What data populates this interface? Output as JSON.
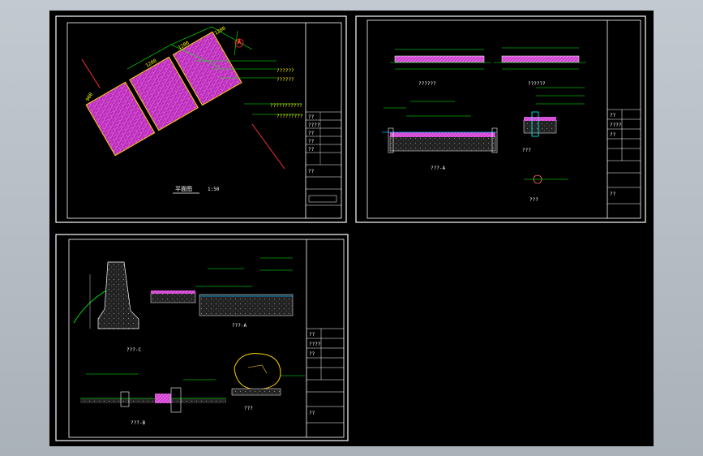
{
  "sheets": [
    {
      "id": "plan",
      "scale_label": "平面图",
      "scale_value": "1:50",
      "dims": [
        "1200",
        "1200",
        "1200",
        "900"
      ],
      "notes": [
        "??????",
        "??????",
        "???????????",
        "?????????"
      ],
      "title_block": [
        "??",
        "????",
        "??",
        "??",
        "??",
        "??"
      ]
    },
    {
      "id": "sections",
      "labels": [
        "??????",
        "??????",
        "???-A",
        "???",
        "???"
      ],
      "title_block": [
        "??",
        "????",
        "??",
        "??"
      ]
    },
    {
      "id": "details",
      "labels": [
        "???-C",
        "???-A",
        "???-B",
        "???"
      ],
      "title_block": [
        "??",
        "????",
        "??",
        "??"
      ]
    }
  ],
  "colors": {
    "paving": "#cc33cc",
    "frame": "#ffffff",
    "dimension": "#00ff00",
    "text": "#ffff00",
    "background": "#000000"
  },
  "icons": [
    "north-arrow-icon"
  ]
}
